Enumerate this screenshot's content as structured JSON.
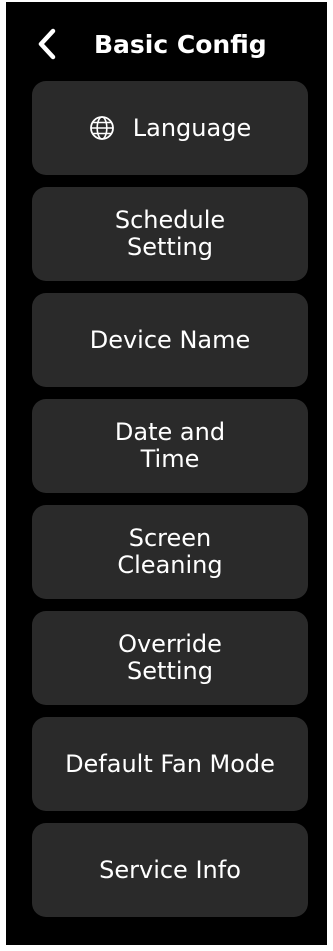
{
  "header": {
    "title": "Basic Config",
    "back_icon": "chevron-left-icon"
  },
  "menu": {
    "items": [
      {
        "label": "Language",
        "icon": "globe-icon"
      },
      {
        "label": "Schedule\nSetting"
      },
      {
        "label": "Device Name"
      },
      {
        "label": "Date and\nTime"
      },
      {
        "label": "Screen\nCleaning"
      },
      {
        "label": "Override\nSetting"
      },
      {
        "label": "Default Fan Mode"
      },
      {
        "label": "Service Info"
      }
    ]
  },
  "colors": {
    "background": "#000000",
    "card": "#2a2a2a",
    "text": "#ffffff"
  }
}
